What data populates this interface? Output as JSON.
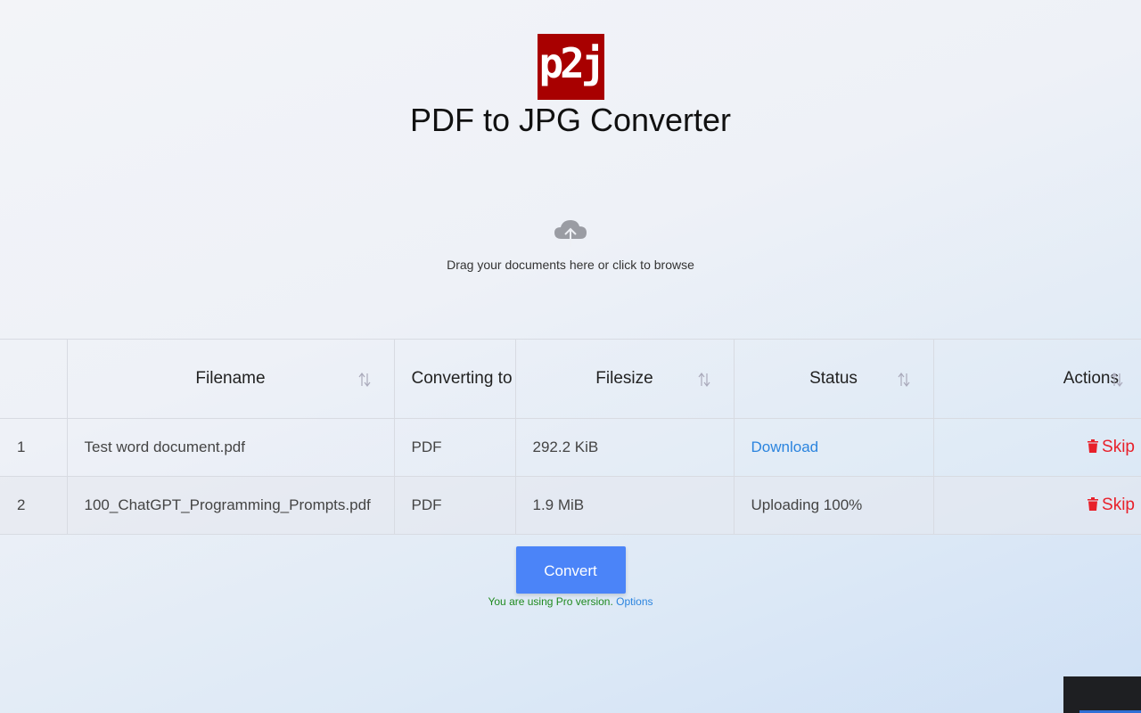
{
  "header": {
    "logo_text": "p2j",
    "title": "PDF to JPG Converter"
  },
  "drop_zone": {
    "icon": "cloud-upload-icon",
    "text": "Drag your documents here or click to browse"
  },
  "table": {
    "columns": {
      "index": "",
      "filename": "Filename",
      "converting_to": "Converting to",
      "filesize": "Filesize",
      "status": "Status",
      "actions": "Actions"
    },
    "rows": [
      {
        "index": "1",
        "filename": "Test word document.pdf",
        "converting_to": "PDF",
        "filesize": "292.2 KiB",
        "status": "Download",
        "action": "Skip"
      },
      {
        "index": "2",
        "filename": "100_ChatGPT_Programming_Prompts.pdf",
        "converting_to": "PDF",
        "filesize": "1.9 MiB",
        "status": "Uploading 100%",
        "action": "Skip"
      }
    ]
  },
  "convert": {
    "button_label": "Convert",
    "pro_text": "You are using Pro version.",
    "options_link": "Options"
  },
  "colors": {
    "logo_bg": "#a80000",
    "button": "#4b84f8",
    "link": "#2b84de",
    "skip": "#e8202a",
    "pro_text": "#1f8a1f"
  }
}
